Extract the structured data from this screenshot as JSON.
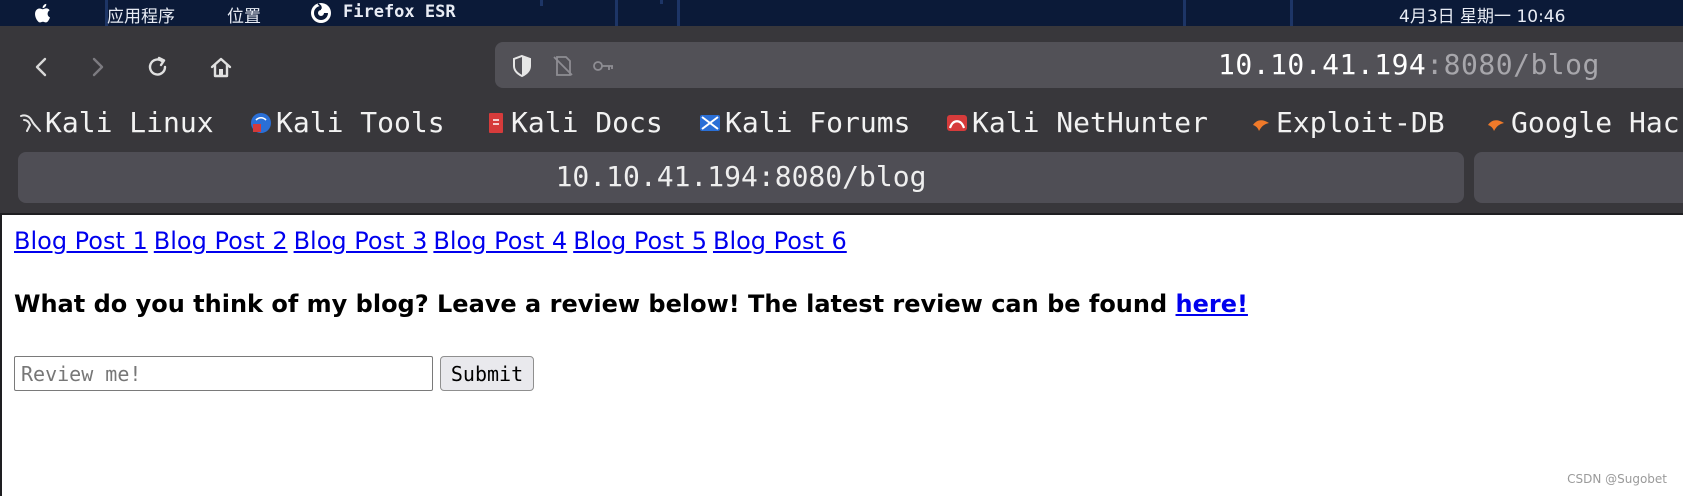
{
  "system_bar": {
    "menu_applications": "应用程序",
    "menu_places": "位置",
    "app_name": "Firefox ESR",
    "clock": "4月3日 星期一 10:46"
  },
  "toolbar": {
    "icons": [
      "back-icon",
      "forward-icon",
      "reload-icon",
      "home-icon"
    ],
    "url_host": "10.10.41.194",
    "url_rest": ":8080/blog"
  },
  "bookmarks": [
    {
      "label": "Kali Linux",
      "icon": "kali-dragon-icon"
    },
    {
      "label": "Kali Tools",
      "icon": "kali-tools-icon"
    },
    {
      "label": "Kali Docs",
      "icon": "kali-docs-icon"
    },
    {
      "label": "Kali Forums",
      "icon": "kali-forums-icon"
    },
    {
      "label": "Kali NetHunter",
      "icon": "kali-nethunter-icon"
    },
    {
      "label": "Exploit-DB",
      "icon": "exploit-db-icon"
    },
    {
      "label": "Google Hac",
      "icon": "google-hacking-icon"
    }
  ],
  "tab": {
    "title": "10.10.41.194:8080/blog"
  },
  "page": {
    "blog_links": [
      "Blog Post 1",
      "Blog Post 2",
      "Blog Post 3",
      "Blog Post 4",
      "Blog Post 5",
      "Blog Post 6"
    ],
    "heading_text": "What do you think of my blog? Leave a review below! The latest review can be found ",
    "heading_link": "here!",
    "review_placeholder": "Review me!",
    "submit_label": "Submit"
  },
  "watermark": "CSDN @Sugobet",
  "colors": {
    "system_bar": "#0b1a38",
    "chrome_bg": "#38373b",
    "urlbar_bg": "#525157",
    "tab_bg": "#4f4e55",
    "link": "#0000ee"
  }
}
